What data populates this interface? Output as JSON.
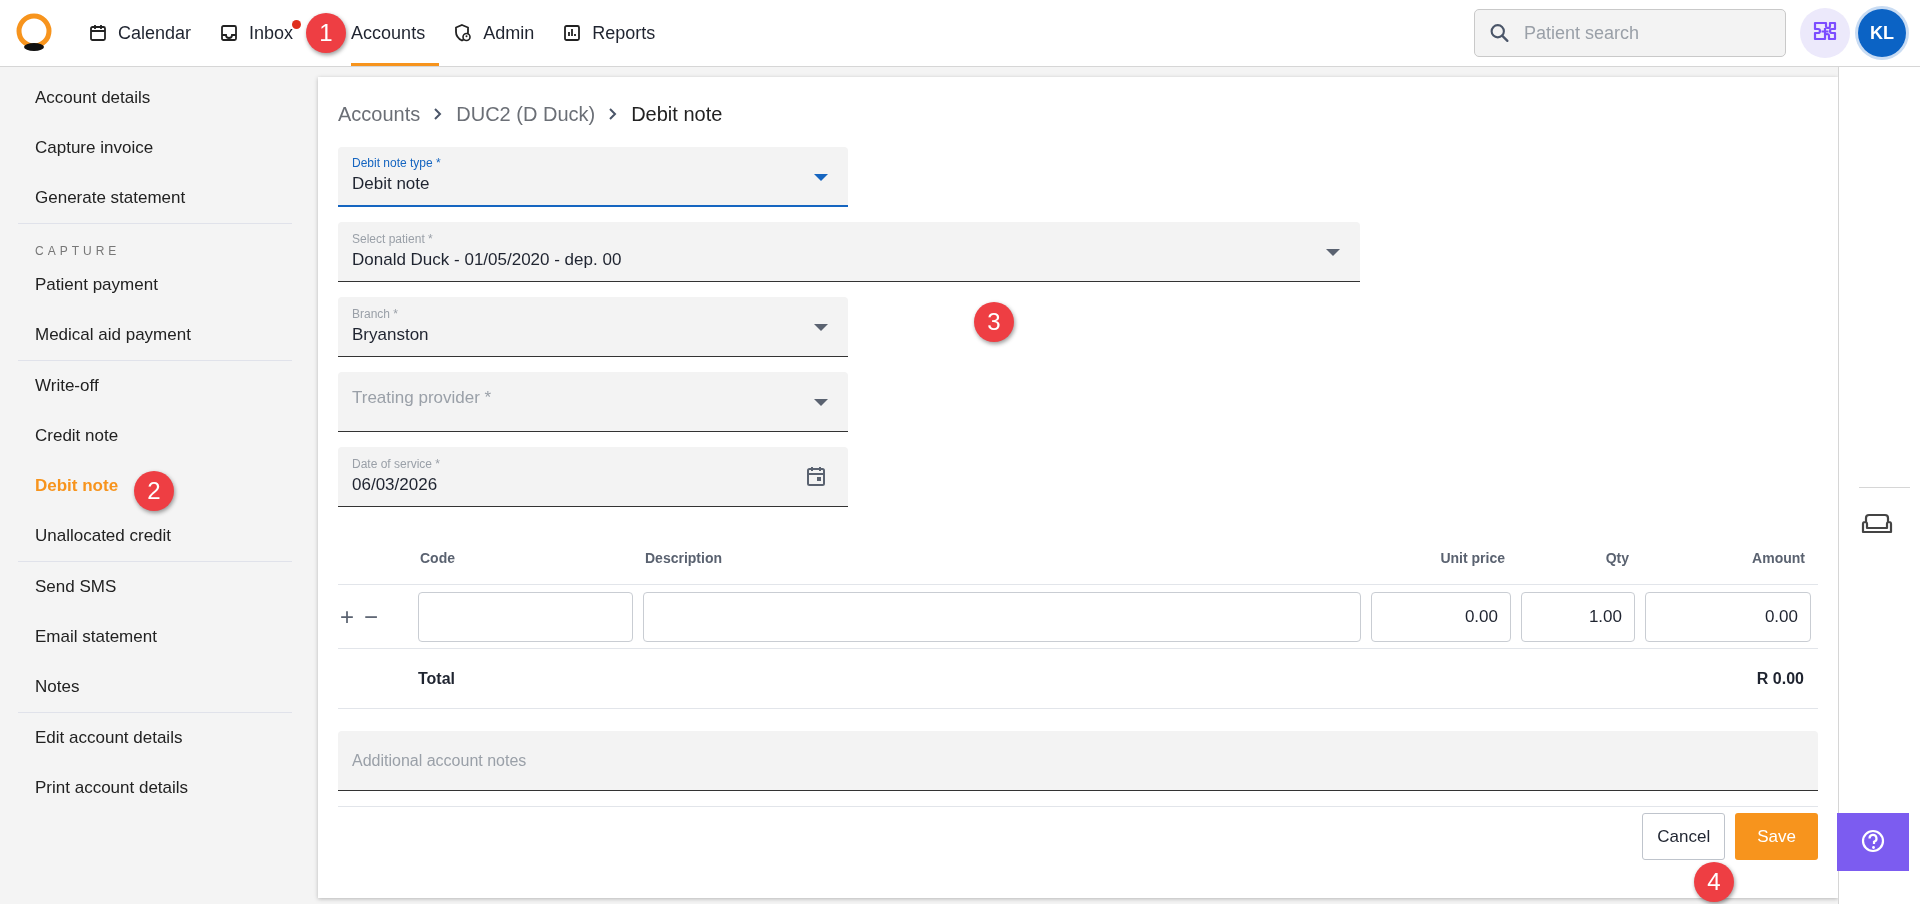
{
  "nav": [
    {
      "label": "Calendar",
      "badge": false,
      "selected": false
    },
    {
      "label": "Inbox",
      "badge": true,
      "selected": false
    },
    {
      "label": "Accounts",
      "badge": false,
      "selected": true
    },
    {
      "label": "Admin",
      "badge": false,
      "selected": false
    },
    {
      "label": "Reports",
      "badge": false,
      "selected": false
    }
  ],
  "search": {
    "placeholder": "Patient search"
  },
  "avatar": "KL",
  "sidebar": [
    {
      "kind": "item",
      "label": "Account details",
      "selected": false
    },
    {
      "kind": "item",
      "label": "Capture invoice",
      "selected": false
    },
    {
      "kind": "item",
      "label": "Generate statement",
      "selected": false
    },
    {
      "kind": "divider"
    },
    {
      "kind": "heading",
      "label": "CAPTURE"
    },
    {
      "kind": "item",
      "label": "Patient payment",
      "selected": false
    },
    {
      "kind": "item",
      "label": "Medical aid payment",
      "selected": false
    },
    {
      "kind": "divider"
    },
    {
      "kind": "item",
      "label": "Write-off",
      "selected": false
    },
    {
      "kind": "item",
      "label": "Credit note",
      "selected": false
    },
    {
      "kind": "item",
      "label": "Debit note",
      "selected": true
    },
    {
      "kind": "item",
      "label": "Unallocated credit",
      "selected": false
    },
    {
      "kind": "divider"
    },
    {
      "kind": "item",
      "label": "Send SMS",
      "selected": false
    },
    {
      "kind": "item",
      "label": "Email statement",
      "selected": false
    },
    {
      "kind": "item",
      "label": "Notes",
      "selected": false
    },
    {
      "kind": "divider"
    },
    {
      "kind": "item",
      "label": "Edit account details",
      "selected": false
    },
    {
      "kind": "item",
      "label": "Print account details",
      "selected": false
    }
  ],
  "breadcrumb": [
    "Accounts",
    "DUC2 (D Duck)",
    "Debit note"
  ],
  "fields": [
    {
      "kind": "select",
      "label": "Debit note type *",
      "value": "Debit note",
      "focused": true,
      "wide": false
    },
    {
      "kind": "select",
      "label": "Select patient *",
      "value": "Donald Duck - 01/05/2020 - dep. 00",
      "focused": false,
      "wide": true
    },
    {
      "kind": "select",
      "label": "Branch *",
      "value": "Bryanston",
      "focused": false,
      "wide": false
    },
    {
      "kind": "select",
      "placeholder": "Treating provider *",
      "focused": false,
      "wide": false
    },
    {
      "kind": "date",
      "label": "Date of service *",
      "value": "06/03/2026",
      "focused": false,
      "wide": false
    }
  ],
  "table": {
    "columns": [
      "Code",
      "Description",
      "Unit price",
      "Qty",
      "Amount"
    ],
    "rows": [
      {
        "add": "+",
        "remove": "−",
        "code": "",
        "description": "",
        "unit_price": "0.00",
        "qty": "1.00",
        "amount": "0.00"
      }
    ],
    "total_label": "Total",
    "total": "R 0.00"
  },
  "notes": {
    "placeholder": "Additional account notes"
  },
  "buttons": {
    "cancel": "Cancel",
    "save": "Save"
  },
  "callouts": [
    "1",
    "2",
    "3",
    "4"
  ]
}
